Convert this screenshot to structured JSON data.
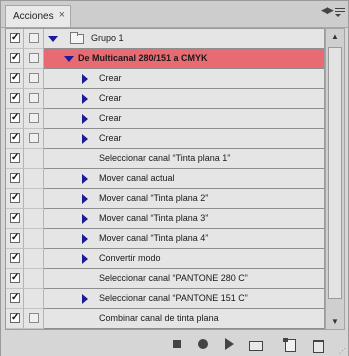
{
  "panel": {
    "tab_label": "Acciones",
    "close_glyph": "×",
    "collapse_glyph": "◀▶"
  },
  "rows": [
    {
      "label": "Grupo 1",
      "type": "group",
      "checked": true,
      "box": true,
      "disclosure": "down"
    },
    {
      "label": "De Multicanal 280/151 a CMYK",
      "type": "action",
      "checked": true,
      "box": true,
      "disclosure": "down",
      "selected": true
    },
    {
      "label": "Crear",
      "type": "step",
      "checked": true,
      "box": true,
      "disclosure": "right"
    },
    {
      "label": "Crear",
      "type": "step",
      "checked": true,
      "box": true,
      "disclosure": "right"
    },
    {
      "label": "Crear",
      "type": "step",
      "checked": true,
      "box": true,
      "disclosure": "right"
    },
    {
      "label": "Crear",
      "type": "step",
      "checked": true,
      "box": true,
      "disclosure": "right"
    },
    {
      "label": "Seleccionar canal “Tinta plana 1”",
      "type": "step",
      "checked": true,
      "box": false,
      "disclosure": "none"
    },
    {
      "label": "Mover canal actual",
      "type": "step",
      "checked": true,
      "box": false,
      "disclosure": "right"
    },
    {
      "label": "Mover canal “Tinta plana 2”",
      "type": "step",
      "checked": true,
      "box": false,
      "disclosure": "right"
    },
    {
      "label": "Mover canal “Tinta plana 3”",
      "type": "step",
      "checked": true,
      "box": false,
      "disclosure": "right"
    },
    {
      "label": "Mover canal “Tinta plana 4”",
      "type": "step",
      "checked": true,
      "box": false,
      "disclosure": "right"
    },
    {
      "label": "Convertir modo",
      "type": "step",
      "checked": true,
      "box": false,
      "disclosure": "right"
    },
    {
      "label": "Seleccionar canal “PANTONE 280 C”",
      "type": "step",
      "checked": true,
      "box": false,
      "disclosure": "none"
    },
    {
      "label": "Seleccionar canal “PANTONE 151 C”",
      "type": "step",
      "checked": true,
      "box": false,
      "disclosure": "right"
    },
    {
      "label": "Combinar canal de tinta plana",
      "type": "step",
      "checked": true,
      "box": true,
      "disclosure": "none"
    }
  ],
  "colors": {
    "selected_row": "#e86a72",
    "disclosure": "#1a1a9a"
  },
  "toolbar": {
    "icons": [
      "stop-icon",
      "record-icon",
      "play-icon",
      "new-set-icon",
      "new-action-icon",
      "trash-icon"
    ]
  }
}
